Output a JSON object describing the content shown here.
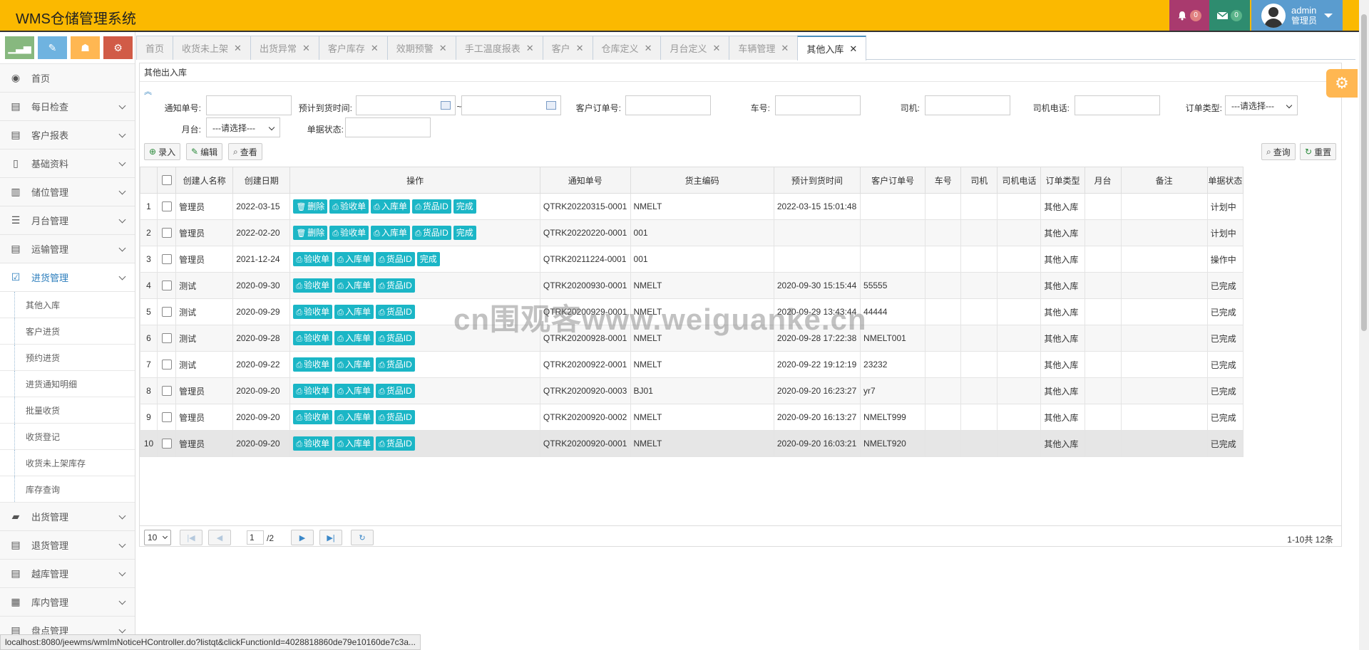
{
  "app": {
    "title": "WMS仓储管理系统"
  },
  "topbar": {
    "bell_count": "0",
    "mail_count": "0",
    "user_name": "admin",
    "user_role": "管理员",
    "icons": [
      "bell-icon",
      "mail-icon",
      "user-avatar",
      "caret-down-icon"
    ],
    "colors": {
      "bar": "#fbb900",
      "bell": "#a93a6e",
      "mail": "#2e8c6f",
      "user": "#5a9ccf"
    }
  },
  "shortcuts": [
    "chart-icon",
    "pencil-icon",
    "group-icon",
    "cogs-icon"
  ],
  "sidebar": {
    "home": "首页",
    "items": [
      {
        "label": "每日检查",
        "icon": "list-icon"
      },
      {
        "label": "客户报表",
        "icon": "list-icon"
      },
      {
        "label": "基础资料",
        "icon": "file-icon"
      },
      {
        "label": "储位管理",
        "icon": "building-icon"
      },
      {
        "label": "月台管理",
        "icon": "list-icon"
      },
      {
        "label": "运输管理",
        "icon": "list-icon"
      },
      {
        "label": "进货管理",
        "icon": "check-square-icon",
        "active": true
      }
    ],
    "submenu": [
      "其他入库",
      "客户进货",
      "预约进货",
      "进货通知明细",
      "批量收货",
      "收货登记",
      "收货未上架库存",
      "库存查询"
    ],
    "items_after": [
      {
        "label": "出货管理",
        "icon": "truck-icon"
      },
      {
        "label": "退货管理",
        "icon": "list-icon"
      },
      {
        "label": "越库管理",
        "icon": "list-icon"
      },
      {
        "label": "库内管理",
        "icon": "film-icon"
      },
      {
        "label": "盘点管理",
        "icon": "list-icon"
      }
    ]
  },
  "tabs": [
    {
      "label": "首页",
      "closable": false
    },
    {
      "label": "收货未上架",
      "closable": true
    },
    {
      "label": "出货异常",
      "closable": true
    },
    {
      "label": "客户库存",
      "closable": true
    },
    {
      "label": "效期预警",
      "closable": true
    },
    {
      "label": "手工温度报表",
      "closable": true
    },
    {
      "label": "客户",
      "closable": true
    },
    {
      "label": "仓库定义",
      "closable": true
    },
    {
      "label": "月台定义",
      "closable": true
    },
    {
      "label": "车辆管理",
      "closable": true
    },
    {
      "label": "其他入库",
      "closable": true,
      "active": true
    }
  ],
  "panel": {
    "title": "其他出入库"
  },
  "search": {
    "notice_no": "通知单号:",
    "eta": "预计到货时间:",
    "tilde": "~",
    "cust_order": "客户订单号:",
    "car_no": "车号:",
    "driver": "司机:",
    "driver_phone": "司机电话:",
    "order_type": "订单类型:",
    "order_type_value": "---请选择---",
    "dock": "月台:",
    "dock_value": "---请选择---",
    "status": "单据状态:"
  },
  "toolbar": {
    "add": "录入",
    "edit": "编辑",
    "view": "查看",
    "query": "查询",
    "reset": "重置"
  },
  "table": {
    "headers": [
      "创建人名称",
      "创建日期",
      "操作",
      "通知单号",
      "货主编码",
      "预计到货时间",
      "客户订单号",
      "车号",
      "司机",
      "司机电话",
      "订单类型",
      "月台",
      "备注",
      "单据状态"
    ],
    "op_labels": {
      "delete": "删除",
      "check": "验收单",
      "inbound": "入库单",
      "goods": "货品ID",
      "done": "完成"
    },
    "rows": [
      {
        "no": "1",
        "creator": "管理员",
        "date": "2022-03-15",
        "ops": [
          "delete",
          "check",
          "inbound",
          "goods",
          "done"
        ],
        "notice": "QTRK20220315-0001",
        "owner": "NMELT",
        "eta": "2022-03-15 15:01:48",
        "cust": "",
        "car": "",
        "driver": "",
        "phone": "",
        "type": "其他入库",
        "dock": "",
        "remark": "",
        "status": "计划中"
      },
      {
        "no": "2",
        "creator": "管理员",
        "date": "2022-02-20",
        "ops": [
          "delete",
          "check",
          "inbound",
          "goods",
          "done"
        ],
        "notice": "QTRK20220220-0001",
        "owner": "001",
        "eta": "",
        "cust": "",
        "car": "",
        "driver": "",
        "phone": "",
        "type": "其他入库",
        "dock": "",
        "remark": "",
        "status": "计划中"
      },
      {
        "no": "3",
        "creator": "管理员",
        "date": "2021-12-24",
        "ops": [
          "check",
          "inbound",
          "goods",
          "done"
        ],
        "notice": "QTRK20211224-0001",
        "owner": "001",
        "eta": "",
        "cust": "",
        "car": "",
        "driver": "",
        "phone": "",
        "type": "其他入库",
        "dock": "",
        "remark": "",
        "status": "操作中"
      },
      {
        "no": "4",
        "creator": "测试",
        "date": "2020-09-30",
        "ops": [
          "check",
          "inbound",
          "goods"
        ],
        "notice": "QTRK20200930-0001",
        "owner": "NMELT",
        "eta": "2020-09-30 15:15:44",
        "cust": "55555",
        "car": "",
        "driver": "",
        "phone": "",
        "type": "其他入库",
        "dock": "",
        "remark": "",
        "status": "已完成"
      },
      {
        "no": "5",
        "creator": "测试",
        "date": "2020-09-29",
        "ops": [
          "check",
          "inbound",
          "goods"
        ],
        "notice": "QTRK20200929-0001",
        "owner": "NMELT",
        "eta": "2020-09-29 13:43:44",
        "cust": "44444",
        "car": "",
        "driver": "",
        "phone": "",
        "type": "其他入库",
        "dock": "",
        "remark": "",
        "status": "已完成"
      },
      {
        "no": "6",
        "creator": "测试",
        "date": "2020-09-28",
        "ops": [
          "check",
          "inbound",
          "goods"
        ],
        "notice": "QTRK20200928-0001",
        "owner": "NMELT",
        "eta": "2020-09-28 17:22:38",
        "cust": "NMELT001",
        "car": "",
        "driver": "",
        "phone": "",
        "type": "其他入库",
        "dock": "",
        "remark": "",
        "status": "已完成"
      },
      {
        "no": "7",
        "creator": "测试",
        "date": "2020-09-22",
        "ops": [
          "check",
          "inbound",
          "goods"
        ],
        "notice": "QTRK20200922-0001",
        "owner": "NMELT",
        "eta": "2020-09-22 19:12:19",
        "cust": "23232",
        "car": "",
        "driver": "",
        "phone": "",
        "type": "其他入库",
        "dock": "",
        "remark": "",
        "status": "已完成"
      },
      {
        "no": "8",
        "creator": "管理员",
        "date": "2020-09-20",
        "ops": [
          "check",
          "inbound",
          "goods"
        ],
        "notice": "QTRK20200920-0003",
        "owner": "BJ01",
        "eta": "2020-09-20 16:23:27",
        "cust": "yr7",
        "car": "",
        "driver": "",
        "phone": "",
        "type": "其他入库",
        "dock": "",
        "remark": "",
        "status": "已完成"
      },
      {
        "no": "9",
        "creator": "管理员",
        "date": "2020-09-20",
        "ops": [
          "check",
          "inbound",
          "goods"
        ],
        "notice": "QTRK20200920-0002",
        "owner": "NMELT",
        "eta": "2020-09-20 16:13:27",
        "cust": "NMELT999",
        "car": "",
        "driver": "",
        "phone": "",
        "type": "其他入库",
        "dock": "",
        "remark": "",
        "status": "已完成"
      },
      {
        "no": "10",
        "creator": "管理员",
        "date": "2020-09-20",
        "ops": [
          "check",
          "inbound",
          "goods"
        ],
        "notice": "QTRK20200920-0001",
        "owner": "NMELT",
        "eta": "2020-09-20 16:03:21",
        "cust": "NMELT920",
        "car": "",
        "driver": "",
        "phone": "",
        "type": "其他入库",
        "dock": "",
        "remark": "",
        "status": "已完成"
      }
    ]
  },
  "pager": {
    "page_size": "10",
    "page": "1",
    "total_pages": "/2",
    "info": "1-10共 12条"
  },
  "watermark": "cn围观客www.weiguanke.cn",
  "statusbar": "localhost:8080/jeewms/wmImNoticeHController.do?listqt&clickFunctionId=4028818860de79e10160de7c3a..."
}
